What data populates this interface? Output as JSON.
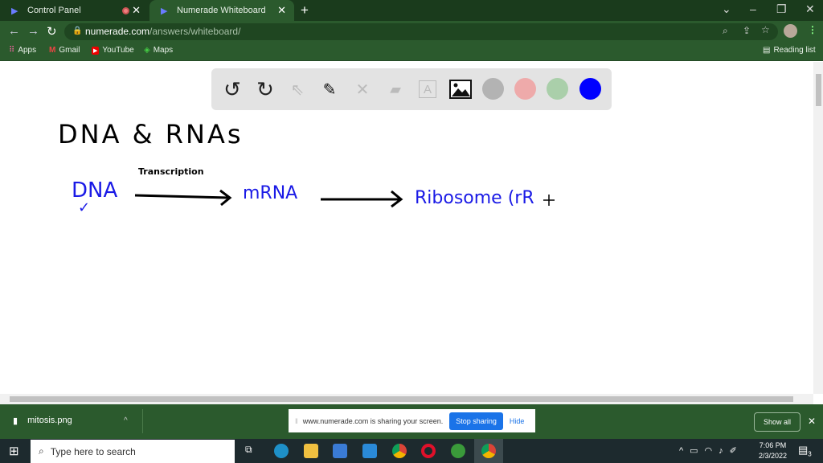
{
  "tabs": [
    {
      "label": "Control Panel",
      "recording": true
    },
    {
      "label": "Numerade Whiteboard",
      "active": true
    }
  ],
  "address": {
    "domain": "numerade.com",
    "path": "/answers/whiteboard/"
  },
  "bookmarks": [
    {
      "label": "Apps"
    },
    {
      "label": "Gmail"
    },
    {
      "label": "YouTube"
    },
    {
      "label": "Maps"
    }
  ],
  "reading_list": "Reading list",
  "toolbar": {
    "tools": [
      "undo-icon",
      "redo-icon",
      "select-icon",
      "pen-icon",
      "tools-icon",
      "eraser-icon",
      "text-icon",
      "image-icon"
    ],
    "colors": [
      "#b3b3b3",
      "#eeaaaa",
      "#aacfaa",
      "#0000ff"
    ]
  },
  "board": {
    "title": "DNA & RNAs",
    "label_above": "Transcription",
    "dna": "DNA",
    "check": "✓",
    "mrna": "mRNA",
    "ribosome": "Ribosome (rR",
    "ink_black": "#000000",
    "ink_blue": "#1a1ae6"
  },
  "download": {
    "file": "mitosis.png",
    "show_all": "Show all"
  },
  "sharing": {
    "message": "www.numerade.com is sharing your screen.",
    "stop": "Stop sharing",
    "hide": "Hide"
  },
  "taskbar": {
    "search_placeholder": "Type here to search",
    "time": "7:06 PM",
    "date": "2/3/2022",
    "notifications": "3"
  }
}
